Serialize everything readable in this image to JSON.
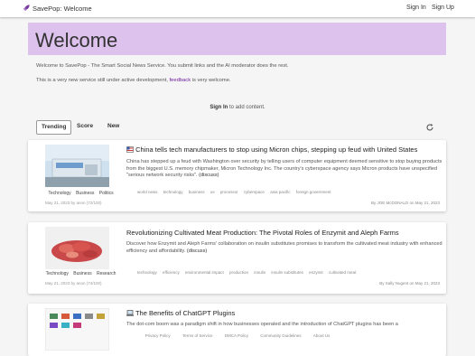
{
  "app": {
    "name": "SavePop: Welcome"
  },
  "nav": {
    "signin": "Sign In",
    "signup": "Sign Up"
  },
  "hero": {
    "title": "Welcome"
  },
  "intro": {
    "line1": "Welcome to SavePop - The Smart Social News Service. You submit links and the AI moderator does the rest.",
    "line2_pre": "This is a very new service still under active development, ",
    "line2_link": "feedback",
    "line2_post": " is very welcome."
  },
  "signin_prompt": {
    "link": "Sign In",
    "text": " to add content."
  },
  "tabs": [
    "Trending",
    "Score",
    "New"
  ],
  "colors": {
    "accent": "#dcc2ec",
    "brand_icon": "#7b3fa0"
  },
  "articles": [
    {
      "title": "China tells tech manufacturers to stop using Micron chips, stepping up feud with United States",
      "title_icon": "flag-icon",
      "summary": "China has stepped up a feud with Washington over security by telling users of computer equipment deemed sensitive to stop buying products from the biggest U.S. memory chipmaker, Micron Technology Inc. The country's cyberspace agency says Micron products have unspecified \"serious network security risks\".",
      "discuss": "(discuss)",
      "tags": [
        "Technology",
        "Business",
        "Politics"
      ],
      "meta": "May 21, 2023 by anon (72/100)",
      "keywords": [
        "world news",
        "technology",
        "business",
        "us",
        "processor",
        "cyberspace",
        "asia pacific",
        "foreign government"
      ],
      "byline": "By JOE McDONALD on May 21, 2023"
    },
    {
      "title": "Revolutionizing Cultivated Meat Production: The Pivotal Roles of Enzymit and Aleph Farms",
      "summary": "Discover how Enzymit and Aleph Farms' collaboration on insulin substitutes promises to transform the cultivated meat industry with enhanced efficiency and affordability.",
      "discuss": "(discuss)",
      "tags": [
        "Technology",
        "Business",
        "Research"
      ],
      "meta": "May 21, 2023 by anon (74/100)",
      "keywords": [
        "technology",
        "efficiency",
        "environmental impact",
        "production",
        "insulin",
        "insulin substitutes",
        "enzymit",
        "cultivated meat"
      ],
      "byline": "By Sally Nugent on May 21, 2023"
    },
    {
      "title": "The Benefits of ChatGPT Plugins",
      "title_icon": "laptop-icon",
      "summary": "The dot-com boom was a paradigm shift in how businesses operated and the introduction of ChatGPT plugins has been a"
    }
  ],
  "footer": [
    "Privacy Policy",
    "Terms of Service",
    "DMCA Policy",
    "Community Guidelines",
    "About Us"
  ]
}
